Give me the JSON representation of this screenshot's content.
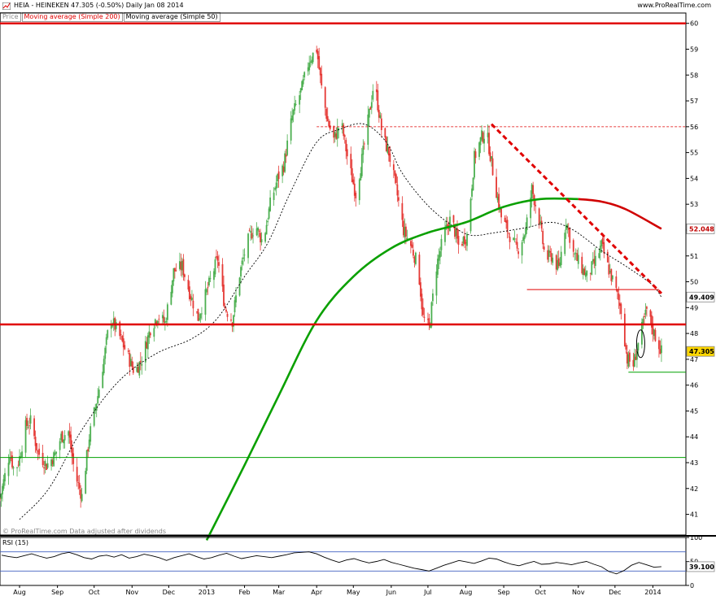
{
  "header": {
    "title": "HEIA - HEINEKEN     47.305 (-0.50%)     Daily  Jan 08 2014",
    "site": "www.ProRealTime.com"
  },
  "legend": {
    "price": "Price",
    "ma200": "Moving average (Simple 200)",
    "ma50": "Moving average (Simple 50)"
  },
  "watermark": "© ProRealTime.com Data adjusted after dividends",
  "colors": {
    "up": "#4caf50",
    "down": "#e53935",
    "ma200": "#0aa000",
    "ma200_tail": "#d00000",
    "ma50": "#000000",
    "resistance": "#e00000",
    "support": "#00a000",
    "rsi_line": "#000000",
    "rsi_ref": "#4060c0",
    "price_badge": "#ffd700"
  },
  "chart_data": [
    {
      "type": "candlestick",
      "title": "HEIA - HEINEKEN",
      "ylim": [
        40.2,
        60.4
      ],
      "y_ticks": [
        41,
        42,
        43,
        44,
        45,
        46,
        47,
        48,
        49,
        50,
        51,
        52,
        53,
        54,
        55,
        56,
        57,
        58,
        59,
        60
      ],
      "x_tick_labels": [
        "Aug",
        "Sep",
        "Oct",
        "Nov",
        "Dec",
        "2013",
        "Feb",
        "Mar",
        "Apr",
        "May",
        "Jun",
        "Jul",
        "Aug",
        "Sep",
        "Oct",
        "Nov",
        "Dec",
        "2014"
      ],
      "x_tick_dates": [
        "2012-08-01",
        "2012-09-01",
        "2012-10-01",
        "2012-11-01",
        "2012-12-01",
        "2013-01-01",
        "2013-02-01",
        "2013-03-01",
        "2013-04-01",
        "2013-05-01",
        "2013-06-01",
        "2013-07-01",
        "2013-08-01",
        "2013-09-01",
        "2013-10-01",
        "2013-11-01",
        "2013-12-01",
        "2014-01-01"
      ],
      "x_range": [
        "2012-07-16",
        "2014-01-28"
      ],
      "close_path": [
        [
          "2012-07-16",
          41.6
        ],
        [
          "2012-07-24",
          43.4
        ],
        [
          "2012-07-28",
          42.6
        ],
        [
          "2012-08-01",
          43.2
        ],
        [
          "2012-08-06",
          44.4
        ],
        [
          "2012-08-10",
          44.6
        ],
        [
          "2012-08-16",
          43.4
        ],
        [
          "2012-08-23",
          42.9
        ],
        [
          "2012-08-30",
          43.3
        ],
        [
          "2012-09-04",
          44.0
        ],
        [
          "2012-09-10",
          44.2
        ],
        [
          "2012-09-15",
          42.6
        ],
        [
          "2012-09-21",
          41.7
        ],
        [
          "2012-09-27",
          44.0
        ],
        [
          "2012-10-04",
          45.6
        ],
        [
          "2012-10-09",
          47.0
        ],
        [
          "2012-10-14",
          48.6
        ],
        [
          "2012-10-20",
          48.1
        ],
        [
          "2012-10-27",
          47.3
        ],
        [
          "2012-11-03",
          46.5
        ],
        [
          "2012-11-09",
          47.0
        ],
        [
          "2012-11-16",
          48.2
        ],
        [
          "2012-11-22",
          48.7
        ],
        [
          "2012-11-28",
          48.4
        ],
        [
          "2012-12-05",
          50.4
        ],
        [
          "2012-12-12",
          50.6
        ],
        [
          "2012-12-18",
          49.6
        ],
        [
          "2012-12-25",
          48.6
        ],
        [
          "2013-01-03",
          49.9
        ],
        [
          "2013-01-10",
          50.9
        ],
        [
          "2013-01-16",
          49.0
        ],
        [
          "2013-01-22",
          48.5
        ],
        [
          "2013-01-28",
          50.3
        ],
        [
          "2013-02-03",
          51.5
        ],
        [
          "2013-02-10",
          52.2
        ],
        [
          "2013-02-16",
          51.5
        ],
        [
          "2013-02-22",
          53.0
        ],
        [
          "2013-02-28",
          54.0
        ],
        [
          "2013-03-05",
          54.5
        ],
        [
          "2013-03-12",
          56.4
        ],
        [
          "2013-03-20",
          57.5
        ],
        [
          "2013-03-26",
          58.6
        ],
        [
          "2013-04-01",
          59.0
        ],
        [
          "2013-04-05",
          57.5
        ],
        [
          "2013-04-10",
          56.2
        ],
        [
          "2013-04-15",
          55.5
        ],
        [
          "2013-04-21",
          56.2
        ],
        [
          "2013-04-27",
          54.6
        ],
        [
          "2013-05-03",
          53.4
        ],
        [
          "2013-05-09",
          55.0
        ],
        [
          "2013-05-15",
          56.8
        ],
        [
          "2013-05-18",
          57.8
        ],
        [
          "2013-05-25",
          55.6
        ],
        [
          "2013-05-30",
          55.0
        ],
        [
          "2013-06-05",
          53.6
        ],
        [
          "2013-06-11",
          52.0
        ],
        [
          "2013-06-17",
          51.4
        ],
        [
          "2013-06-23",
          50.6
        ],
        [
          "2013-06-27",
          48.6
        ],
        [
          "2013-07-02",
          48.2
        ],
        [
          "2013-07-08",
          50.6
        ],
        [
          "2013-07-14",
          51.8
        ],
        [
          "2013-07-20",
          52.5
        ],
        [
          "2013-07-26",
          51.4
        ],
        [
          "2013-08-02",
          51.8
        ],
        [
          "2013-08-08",
          54.8
        ],
        [
          "2013-08-14",
          55.6
        ],
        [
          "2013-08-18",
          55.8
        ],
        [
          "2013-08-24",
          54.0
        ],
        [
          "2013-08-30",
          52.5
        ],
        [
          "2013-09-05",
          51.9
        ],
        [
          "2013-09-12",
          51.2
        ],
        [
          "2013-09-19",
          52.0
        ],
        [
          "2013-09-24",
          53.6
        ],
        [
          "2013-09-30",
          52.4
        ],
        [
          "2013-10-05",
          50.9
        ],
        [
          "2013-10-10",
          51.0
        ],
        [
          "2013-10-16",
          50.5
        ],
        [
          "2013-10-22",
          52.4
        ],
        [
          "2013-10-28",
          51.1
        ],
        [
          "2013-11-03",
          50.6
        ],
        [
          "2013-11-08",
          50.2
        ],
        [
          "2013-11-14",
          50.7
        ],
        [
          "2013-11-20",
          51.4
        ],
        [
          "2013-11-25",
          50.6
        ],
        [
          "2013-12-01",
          49.8
        ],
        [
          "2013-12-06",
          48.9
        ],
        [
          "2013-12-11",
          47.0
        ],
        [
          "2013-12-16",
          46.8
        ],
        [
          "2013-12-21",
          47.8
        ],
        [
          "2013-12-27",
          48.9
        ],
        [
          "2014-01-02",
          48.0
        ],
        [
          "2014-01-08",
          47.305
        ]
      ],
      "sma200": [
        [
          "2013-01-01",
          40.0
        ],
        [
          "2013-02-01",
          42.9
        ],
        [
          "2013-03-01",
          45.6
        ],
        [
          "2013-04-01",
          48.5
        ],
        [
          "2013-05-01",
          50.2
        ],
        [
          "2013-06-01",
          51.3
        ],
        [
          "2013-07-01",
          51.9
        ],
        [
          "2013-08-01",
          52.3
        ],
        [
          "2013-09-01",
          52.9
        ],
        [
          "2013-10-01",
          53.2
        ],
        [
          "2013-11-01",
          53.2
        ]
      ],
      "sma200_tail": [
        [
          "2013-11-01",
          53.2
        ],
        [
          "2013-11-20",
          53.1
        ],
        [
          "2013-12-10",
          52.8
        ],
        [
          "2014-01-08",
          52.048
        ]
      ],
      "sma50": [
        [
          "2012-08-01",
          40.8
        ],
        [
          "2012-08-25",
          42.0
        ],
        [
          "2012-09-20",
          44.2
        ],
        [
          "2012-10-20",
          46.1
        ],
        [
          "2012-11-20",
          47.2
        ],
        [
          "2012-12-20",
          47.8
        ],
        [
          "2013-01-10",
          48.6
        ],
        [
          "2013-02-01",
          50.2
        ],
        [
          "2013-02-20",
          51.5
        ],
        [
          "2013-03-10",
          53.4
        ],
        [
          "2013-04-01",
          55.4
        ],
        [
          "2013-04-20",
          55.9
        ],
        [
          "2013-05-10",
          56.1
        ],
        [
          "2013-05-28",
          55.4
        ],
        [
          "2013-06-10",
          54.2
        ],
        [
          "2013-06-30",
          53.0
        ],
        [
          "2013-07-20",
          52.2
        ],
        [
          "2013-08-05",
          51.8
        ],
        [
          "2013-08-25",
          51.9
        ],
        [
          "2013-09-20",
          52.1
        ],
        [
          "2013-10-10",
          52.3
        ],
        [
          "2013-10-28",
          52.0
        ],
        [
          "2013-11-20",
          51.2
        ],
        [
          "2013-12-10",
          50.6
        ],
        [
          "2013-12-31",
          49.9
        ],
        [
          "2014-01-08",
          49.409
        ]
      ],
      "price_labels": [
        {
          "value": 52.048,
          "label": "52.048"
        },
        {
          "value": 49.409,
          "label": "49.409"
        },
        {
          "value": 47.305,
          "label": "47.305"
        }
      ],
      "annotations": [
        {
          "kind": "hline",
          "y": 60.0
        },
        {
          "kind": "hline",
          "y": 48.35
        },
        {
          "kind": "hline",
          "y": 43.2
        },
        {
          "kind": "dotted_hline",
          "y": 56.0,
          "from": "2013-04-01",
          "to": "2014-01-28"
        },
        {
          "kind": "trend_dashed",
          "from": [
            "2013-08-22",
            56.1
          ],
          "to": [
            "2014-01-08",
            49.55
          ]
        },
        {
          "kind": "segment",
          "y": 49.7,
          "from": "2013-09-20",
          "to": "2014-01-06"
        },
        {
          "kind": "segment",
          "y": 46.5,
          "from": "2013-12-12",
          "to": "2014-01-28"
        },
        {
          "kind": "ellipse",
          "center": [
            "2013-12-22",
            47.6
          ]
        }
      ]
    },
    {
      "type": "line",
      "title": "RSI (15)",
      "ylim": [
        0,
        100
      ],
      "y_ticks": [
        0,
        50,
        100
      ],
      "ref_lines": [
        70,
        30
      ],
      "last_value": 39.1,
      "last_label": "39.100",
      "series": [
        {
          "values": [
            63,
            60,
            58,
            62,
            66,
            61,
            57,
            60,
            66,
            69,
            64,
            58,
            55,
            61,
            63,
            59,
            64,
            57,
            60,
            65,
            62,
            58,
            52,
            58,
            62,
            66,
            60,
            55,
            58,
            63,
            67,
            61,
            56,
            59,
            62,
            60,
            58,
            61,
            64,
            68,
            69,
            70,
            66,
            59,
            53,
            48,
            53,
            56,
            51,
            47,
            50,
            54,
            48,
            44,
            40,
            36,
            33,
            30,
            36,
            42,
            47,
            52,
            49,
            46,
            51,
            57,
            55,
            49,
            44,
            41,
            46,
            50,
            44,
            45,
            48,
            46,
            43,
            47,
            50,
            44,
            39,
            29,
            24,
            31,
            42,
            48,
            43,
            38,
            39.1
          ]
        }
      ]
    }
  ]
}
